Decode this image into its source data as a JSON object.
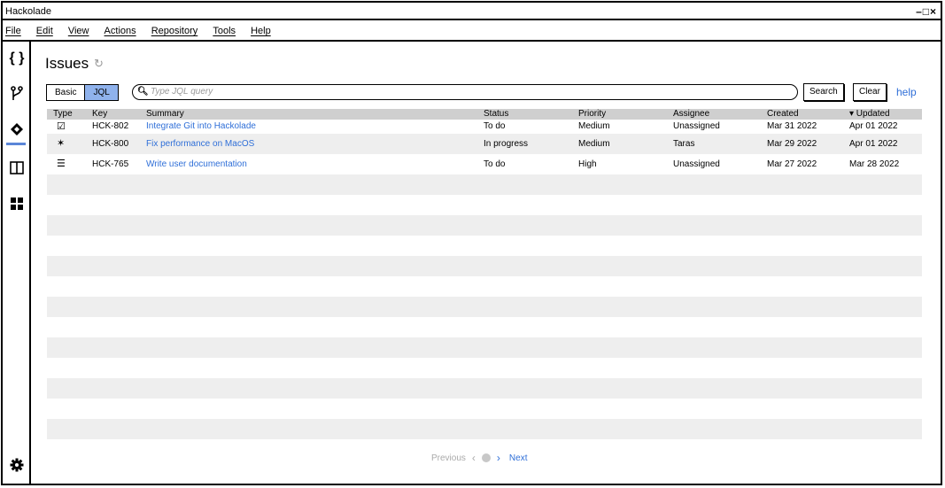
{
  "window": {
    "title": "Hackolade",
    "controls": "–□×"
  },
  "menu": [
    "File",
    "Edit",
    "View",
    "Actions",
    "Repository",
    "Tools",
    "Help"
  ],
  "sidebar": {
    "icons": [
      "braces-icon",
      "branch-icon",
      "jira-icon",
      "columns-icon",
      "grid-icon",
      "settings-icon"
    ],
    "active": "jira-icon"
  },
  "page": {
    "title": "Issues"
  },
  "toolbar": {
    "basic_label": "Basic",
    "jql_label": "JQL",
    "search_placeholder": "Type JQL query",
    "search_label": "Search",
    "clear_label": "Clear",
    "help_label": "help"
  },
  "table": {
    "headers": [
      "Type",
      "Key",
      "Summary",
      "Status",
      "Priority",
      "Assignee",
      "Created",
      "▾ Updated"
    ],
    "rows": [
      {
        "type": "☑",
        "key": "HCK-802",
        "summary": "Integrate Git into Hackolade",
        "status": "To do",
        "priority": "Medium",
        "assignee": "Unassigned",
        "created": "Mar 31 2022",
        "updated": "Apr 01 2022"
      },
      {
        "type": "✶",
        "key": "HCK-800",
        "summary": "Fix performance on MacOS",
        "status": "In progress",
        "priority": "Medium",
        "assignee": "Taras",
        "created": "Mar 29 2022",
        "updated": "Apr 01 2022"
      },
      {
        "type": "☰",
        "key": "HCK-765",
        "summary": "Write user documentation",
        "status": "To do",
        "priority": "High",
        "assignee": "Unassigned",
        "created": "Mar 27 2022",
        "updated": "Mar 28 2022"
      }
    ]
  },
  "pagination": {
    "previous_label": "Previous",
    "next_label": "Next"
  },
  "colors": {
    "accent": "#8fb2ec",
    "link": "#2f6fd8",
    "stripe": "#eeeeee",
    "header": "#cfcfcf"
  }
}
